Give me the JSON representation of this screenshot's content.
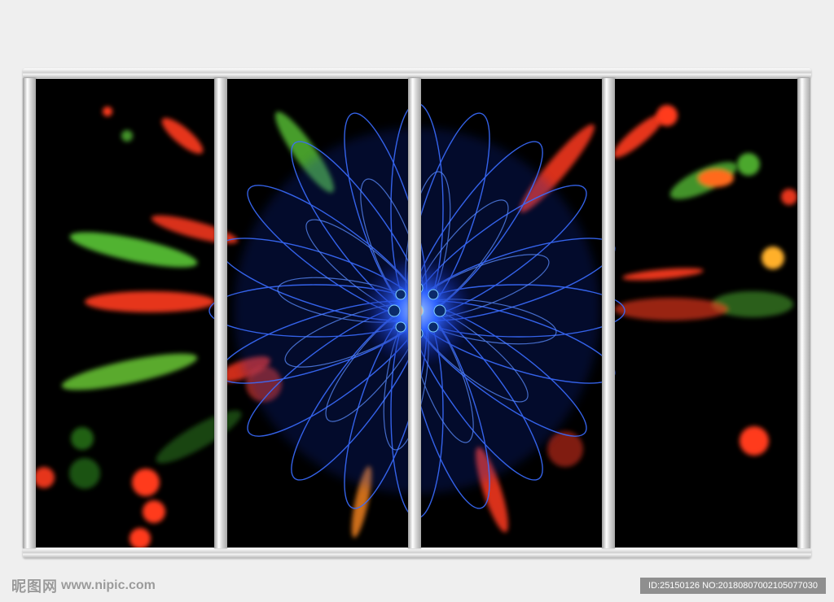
{
  "watermark": {
    "site_logo": "昵图网",
    "site_url": "www.nipic.com",
    "id_text": "ID:25150126 NO:20180807002105077030"
  },
  "artwork": {
    "panels": 4,
    "colors": {
      "center": "#2f63ff",
      "accent_red": "#ff3a1f",
      "accent_green": "#5fd23a",
      "background": "#000000",
      "frame": "#d6d6d6"
    }
  }
}
